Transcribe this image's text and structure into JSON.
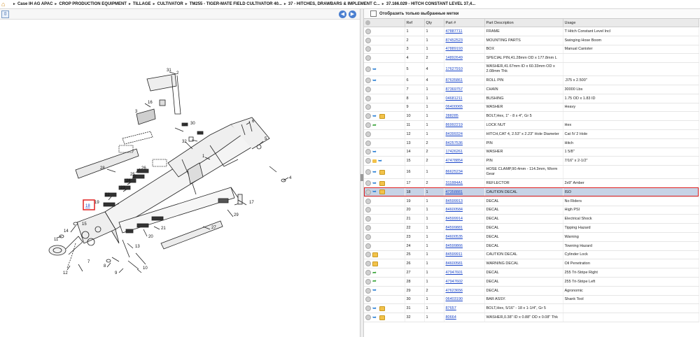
{
  "breadcrumb": [
    "Case IH AG APAC",
    "CROP PRODUCTION EQUIPMENT",
    "TILLAGE",
    "CULTIVATOR",
    "TM255 - TIGER-MATE FIELD CULTIVATOR 40...",
    "37 - HITCHES, DRAWBARS & IMPLEMENT C...",
    "37.166.029 - HITCH CONSTANT LEVEL 37,4..."
  ],
  "filter_label": "Отобразить только выбранные метки",
  "columns": [
    "Ref",
    "Qty",
    "Part #",
    "Part Description",
    "Usage"
  ],
  "rows": [
    {
      "icons": [
        "info"
      ],
      "ref": "1",
      "qty": "1",
      "part": "47887711",
      "desc": "FRAME",
      "usage": "T Hitch Constant Level Incl"
    },
    {
      "icons": [
        "info"
      ],
      "ref": "2",
      "qty": "1",
      "part": "87452523",
      "desc": "MOUNTING PARTS",
      "usage": "Swinging Hose Boom"
    },
    {
      "icons": [
        "info"
      ],
      "ref": "3",
      "qty": "1",
      "part": "47889193",
      "desc": "BOX",
      "usage": "Manual Canister"
    },
    {
      "icons": [
        "info"
      ],
      "ref": "4",
      "qty": "2",
      "part": "14892649",
      "desc": "SPECIAL PIN,41.28mm OD x 177.8mm L",
      "usage": ""
    },
    {
      "icons": [
        "info",
        "arrow"
      ],
      "ref": "5",
      "qty": "4",
      "part": "17627910",
      "desc": "WASHER,41.67mm ID x 60.33mm OD x 2.08mm Thk",
      "usage": "",
      "tall": true
    },
    {
      "icons": [
        "info",
        "arrow"
      ],
      "ref": "6",
      "qty": "4",
      "part": "87635861",
      "desc": "ROLL PIN",
      "usage": ".375 x 2.500\""
    },
    {
      "icons": [
        "info"
      ],
      "ref": "7",
      "qty": "1",
      "part": "87369757",
      "desc": "CHAIN",
      "usage": "30000 Lbs"
    },
    {
      "icons": [
        "info"
      ],
      "ref": "8",
      "qty": "1",
      "part": "04681211",
      "desc": "BUSHING",
      "usage": "1.75 OD x 1.83 ID"
    },
    {
      "icons": [
        "info"
      ],
      "ref": "9",
      "qty": "1",
      "part": "06400065",
      "desc": "WASHER",
      "usage": "Heavy"
    },
    {
      "icons": [
        "info",
        "arrow",
        "box"
      ],
      "ref": "10",
      "qty": "1",
      "part": "288285",
      "desc": "BOLT,Hex, 1\" - 8 x 4\", Gr 5",
      "usage": ""
    },
    {
      "icons": [
        "info",
        "green"
      ],
      "ref": "11",
      "qty": "1",
      "part": "86992219",
      "desc": "LOCK NUT",
      "usage": "Hex"
    },
    {
      "icons": [
        "info"
      ],
      "ref": "12",
      "qty": "1",
      "part": "84399324",
      "desc": "HITCH,CAT 4, 2.53\" x 2.23\" Hole Diameter",
      "usage": "Cat IV 2 Hole"
    },
    {
      "icons": [
        "info"
      ],
      "ref": "13",
      "qty": "2",
      "part": "84257536",
      "desc": "PIN",
      "usage": "Hitch"
    },
    {
      "icons": [
        "info",
        "arrow"
      ],
      "ref": "14",
      "qty": "2",
      "part": "17426261",
      "desc": "WASHER",
      "usage": "1 5/8\""
    },
    {
      "icons": [
        "info",
        "folder",
        "arrow"
      ],
      "ref": "15",
      "qty": "2",
      "part": "47478854",
      "desc": "PIN",
      "usage": "7/16\" x 2-1/2\""
    },
    {
      "icons": [
        "info",
        "arrow",
        "box"
      ],
      "ref": "16",
      "qty": "1",
      "part": "86625234",
      "desc": "HOSE CLAMP,90.4mm - 114.3mm, Worm Gear",
      "usage": "",
      "tall": true
    },
    {
      "icons": [
        "info",
        "arrow",
        "box"
      ],
      "ref": "17",
      "qty": "2",
      "part": "311884A1",
      "desc": "REFLECTOR",
      "usage": "2x9\" Amber"
    },
    {
      "icons": [
        "info",
        "arrow",
        "box"
      ],
      "ref": "18",
      "qty": "1",
      "part": "47358881",
      "desc": "CAUTION DECAL",
      "usage": "ISO",
      "selected": true
    },
    {
      "icons": [
        "info"
      ],
      "ref": "19",
      "qty": "1",
      "part": "84599913",
      "desc": "DECAL",
      "usage": "No Riders"
    },
    {
      "icons": [
        "info"
      ],
      "ref": "20",
      "qty": "1",
      "part": "84600584",
      "desc": "DECAL",
      "usage": "High PSI"
    },
    {
      "icons": [
        "info"
      ],
      "ref": "21",
      "qty": "1",
      "part": "84599914",
      "desc": "DECAL",
      "usage": "Electrical Shock"
    },
    {
      "icons": [
        "info"
      ],
      "ref": "22",
      "qty": "1",
      "part": "84599881",
      "desc": "DECAL",
      "usage": "Tipping Hazard"
    },
    {
      "icons": [
        "info"
      ],
      "ref": "23",
      "qty": "1",
      "part": "84600535",
      "desc": "DECAL",
      "usage": "Warning"
    },
    {
      "icons": [
        "info"
      ],
      "ref": "24",
      "qty": "1",
      "part": "84599866",
      "desc": "DECAL",
      "usage": "Towning Hazard"
    },
    {
      "icons": [
        "info",
        "box"
      ],
      "ref": "25",
      "qty": "1",
      "part": "84599911",
      "desc": "CAUTION DECAL",
      "usage": "Cylinder Lock"
    },
    {
      "icons": [
        "info",
        "box"
      ],
      "ref": "26",
      "qty": "1",
      "part": "84600581",
      "desc": "WARNING DECAL",
      "usage": "Oil Penetration"
    },
    {
      "icons": [
        "info",
        "green"
      ],
      "ref": "27",
      "qty": "1",
      "part": "47947601",
      "desc": "DECAL",
      "usage": "255 Tri-Stripe Right"
    },
    {
      "icons": [
        "info",
        "green"
      ],
      "ref": "28",
      "qty": "1",
      "part": "47947602",
      "desc": "DECAL",
      "usage": "255 Tri-Stripe Left"
    },
    {
      "icons": [
        "info",
        "arrow"
      ],
      "ref": "29",
      "qty": "2",
      "part": "47623656",
      "desc": "DECAL",
      "usage": "Agronomic"
    },
    {
      "icons": [
        "info"
      ],
      "ref": "30",
      "qty": "1",
      "part": "06403190",
      "desc": "BAR ASSY.",
      "usage": "Shank Tool"
    },
    {
      "icons": [
        "info",
        "arrow",
        "box"
      ],
      "ref": "31",
      "qty": "1",
      "part": "87657",
      "desc": "BOLT,Hex, 5/16\" - 18 x 1-1/4\", Gr 5",
      "usage": ""
    },
    {
      "icons": [
        "info",
        "arrow",
        "box"
      ],
      "ref": "32",
      "qty": "1",
      "part": "80664",
      "desc": "WASHER,0.38\" ID x 0.88\" OD x 0.08\" Thk",
      "usage": ""
    }
  ],
  "diagram_labels": [
    "31",
    "2",
    "16",
    "3",
    "30",
    "32",
    "1",
    "6",
    "5",
    "4",
    "28",
    "26",
    "25",
    "24",
    "23",
    "22",
    "19",
    "18",
    "17",
    "29",
    "14",
    "11",
    "21",
    "20",
    "27",
    "13",
    "8",
    "9",
    "7",
    "12",
    "10",
    "15"
  ],
  "highlight_color": "#e02020"
}
